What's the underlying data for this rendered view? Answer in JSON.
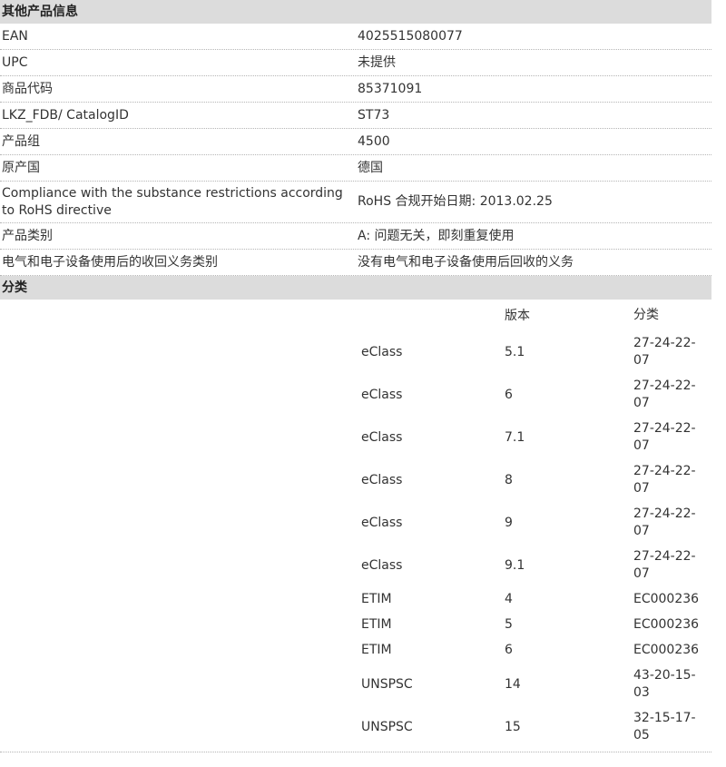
{
  "section1": {
    "title": "其他产品信息",
    "rows": [
      {
        "label": "EAN",
        "value": "4025515080077"
      },
      {
        "label": "UPC",
        "value": "未提供"
      },
      {
        "label": "商品代码",
        "value": "85371091"
      },
      {
        "label": "LKZ_FDB/ CatalogID",
        "value": "ST73"
      },
      {
        "label": "产品组",
        "value": "4500"
      },
      {
        "label": "原产国",
        "value": "德国"
      },
      {
        "label": "Compliance with the substance restrictions according to RoHS directive",
        "value": "RoHS 合规开始日期: 2013.02.25"
      },
      {
        "label": "产品类别",
        "value": "A: 问题无关，即刻重复使用"
      },
      {
        "label": "电气和电子设备使用后的收回义务类别",
        "value": "没有电气和电子设备使用后回收的义务"
      }
    ]
  },
  "section2": {
    "title": "分类",
    "headers": {
      "col1": "",
      "version": "版本",
      "classification": "分类"
    },
    "rows": [
      {
        "system": "eClass",
        "version": "5.1",
        "code": "27-24-22-07"
      },
      {
        "system": "eClass",
        "version": "6",
        "code": "27-24-22-07"
      },
      {
        "system": "eClass",
        "version": "7.1",
        "code": "27-24-22-07"
      },
      {
        "system": "eClass",
        "version": "8",
        "code": "27-24-22-07"
      },
      {
        "system": "eClass",
        "version": "9",
        "code": "27-24-22-07"
      },
      {
        "system": "eClass",
        "version": "9.1",
        "code": "27-24-22-07"
      },
      {
        "system": "ETIM",
        "version": "4",
        "code": "EC000236"
      },
      {
        "system": "ETIM",
        "version": "5",
        "code": "EC000236"
      },
      {
        "system": "ETIM",
        "version": "6",
        "code": "EC000236"
      },
      {
        "system": "UNSPSC",
        "version": "14",
        "code": "43-20-15-03"
      },
      {
        "system": "UNSPSC",
        "version": "15",
        "code": "32-15-17-05"
      }
    ]
  }
}
